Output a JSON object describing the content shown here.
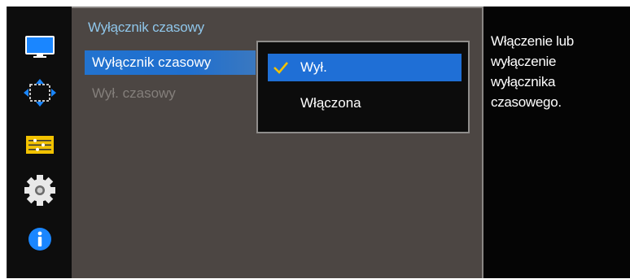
{
  "menu": {
    "title": "Wyłącznik czasowy",
    "items": [
      {
        "label": "Wyłącznik czasowy",
        "state": "selected"
      },
      {
        "label": "Wył. czasowy",
        "state": "disabled"
      }
    ]
  },
  "dropdown": {
    "options": [
      {
        "label": "Wył.",
        "checked": true
      },
      {
        "label": "Włączona",
        "checked": false
      }
    ]
  },
  "description": {
    "text": "Włączenie lub wyłączenie wyłącznika czasowego."
  },
  "sidebar": {
    "icons": [
      "monitor-icon",
      "picture-size-icon",
      "system-settings-icon",
      "gear-icon",
      "info-icon"
    ]
  },
  "colors": {
    "accent_blue": "#1f6fd6",
    "title_blue": "#8fc6ea",
    "panel_bg": "#4c4643",
    "check_yellow": "#f2c200"
  }
}
